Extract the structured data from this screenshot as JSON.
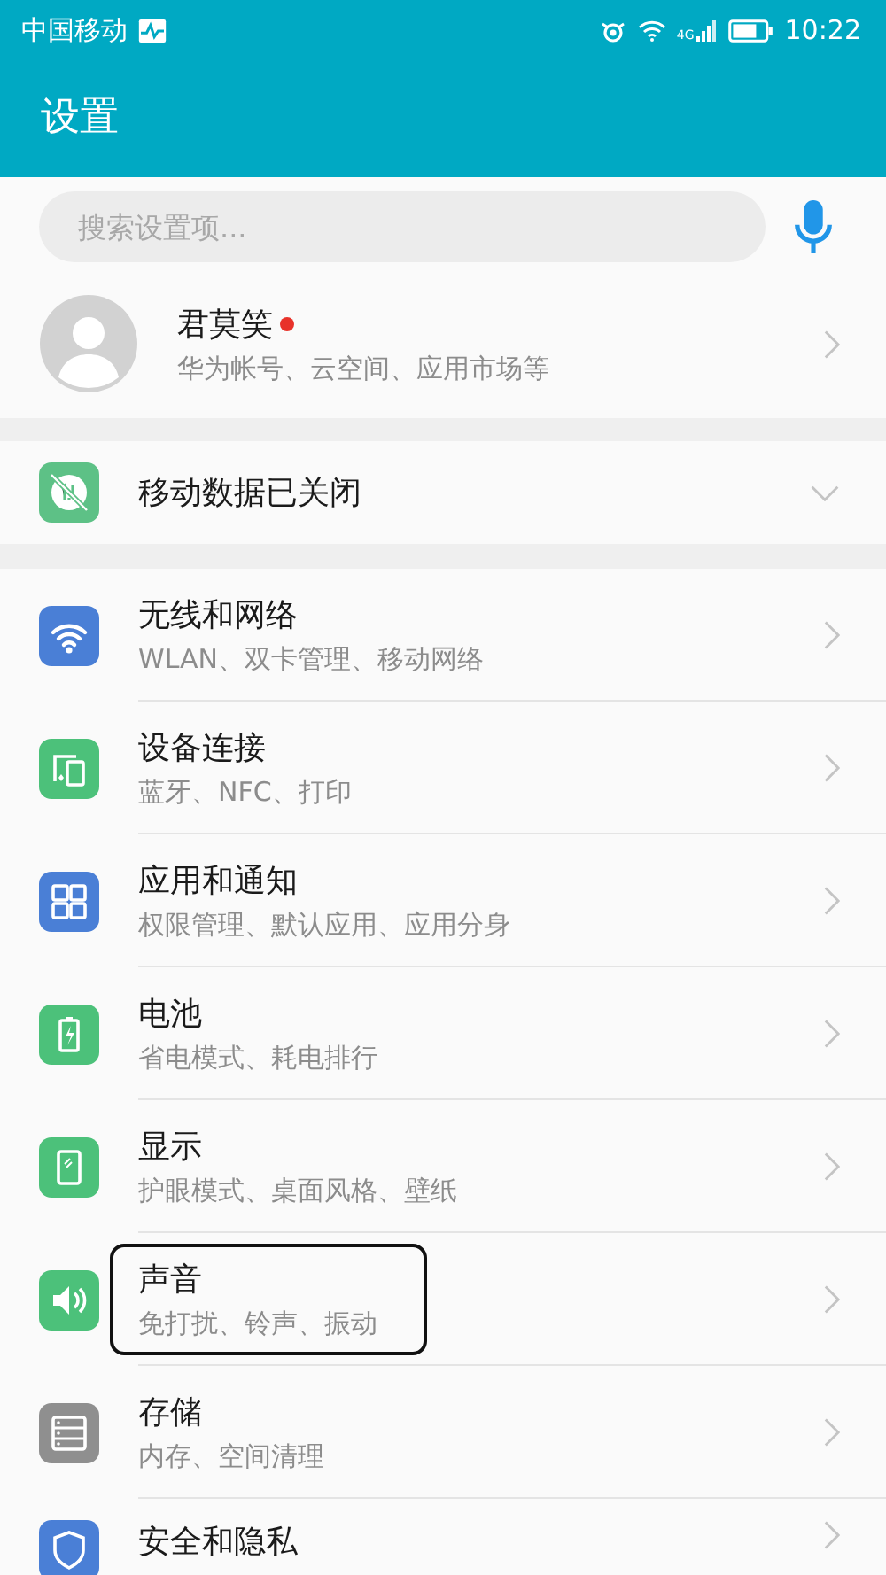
{
  "status_bar": {
    "carrier": "中国移动",
    "network": "4G",
    "time": "10:22"
  },
  "title": "设置",
  "search": {
    "placeholder": "搜索设置项..."
  },
  "account": {
    "name": "君莫笑",
    "badge": true,
    "subtitle": "华为帐号、云空间、应用市场等"
  },
  "mobile_data": {
    "label": "移动数据已关闭",
    "expanded": false
  },
  "items": [
    {
      "title": "无线和网络",
      "subtitle": "WLAN、双卡管理、移动网络",
      "kind": "wifi",
      "color": "#4a7fd6",
      "highlighted": false
    },
    {
      "title": "设备连接",
      "subtitle": "蓝牙、NFC、打印",
      "kind": "devices",
      "color": "#4cc17a",
      "highlighted": false
    },
    {
      "title": "应用和通知",
      "subtitle": "权限管理、默认应用、应用分身",
      "kind": "apps",
      "color": "#4a7fd6",
      "highlighted": false
    },
    {
      "title": "电池",
      "subtitle": "省电模式、耗电排行",
      "kind": "battery",
      "color": "#4cc17a",
      "highlighted": false
    },
    {
      "title": "显示",
      "subtitle": "护眼模式、桌面风格、壁纸",
      "kind": "display",
      "color": "#4cc17a",
      "highlighted": false
    },
    {
      "title": "声音",
      "subtitle": "免打扰、铃声、振动",
      "kind": "sound",
      "color": "#4cc17a",
      "highlighted": true
    },
    {
      "title": "存储",
      "subtitle": "内存、空间清理",
      "kind": "storage",
      "color": "#8f8f8f",
      "highlighted": false
    },
    {
      "title": "安全和隐私",
      "kind": "security",
      "color": "#4a7fd6",
      "highlighted": false
    }
  ]
}
